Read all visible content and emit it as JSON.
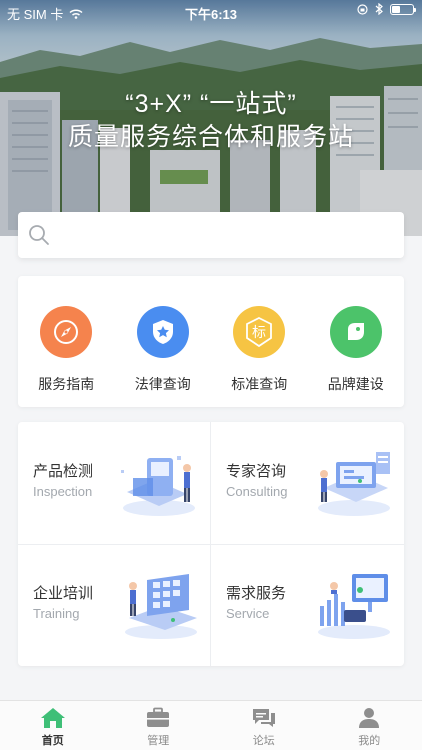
{
  "status_bar": {
    "carrier": "无 SIM 卡",
    "time": "下午6:13"
  },
  "hero": {
    "line1": "“3+X” “一站式”",
    "line2": "质量服务综合体和服务站"
  },
  "search": {
    "placeholder": ""
  },
  "quick_links": [
    {
      "label": "服务指南",
      "icon": "compass-icon",
      "color": "#f5834d"
    },
    {
      "label": "法律查询",
      "icon": "shield-star-icon",
      "color": "#4a8df0"
    },
    {
      "label": "标准查询",
      "icon": "standard-badge-icon",
      "color": "#f6c443",
      "badge_text": "标"
    },
    {
      "label": "品牌建设",
      "icon": "leaf-tag-icon",
      "color": "#4cc36a"
    }
  ],
  "services": [
    {
      "title": "产品检测",
      "subtitle": "Inspection",
      "icon": "inspection-illustration"
    },
    {
      "title": "专家咨询",
      "subtitle": "Consulting",
      "icon": "consulting-illustration"
    },
    {
      "title": "企业培训",
      "subtitle": "Training",
      "icon": "training-illustration"
    },
    {
      "title": "需求服务",
      "subtitle": "Service",
      "icon": "service-illustration"
    }
  ],
  "tabs": [
    {
      "label": "首页",
      "icon": "home-icon",
      "active": true
    },
    {
      "label": "管理",
      "icon": "briefcase-icon",
      "active": false
    },
    {
      "label": "论坛",
      "icon": "chat-icon",
      "active": false
    },
    {
      "label": "我的",
      "icon": "person-icon",
      "active": false
    }
  ],
  "colors": {
    "accent_green": "#3fbf77",
    "tab_inactive": "#8a8a8a"
  }
}
